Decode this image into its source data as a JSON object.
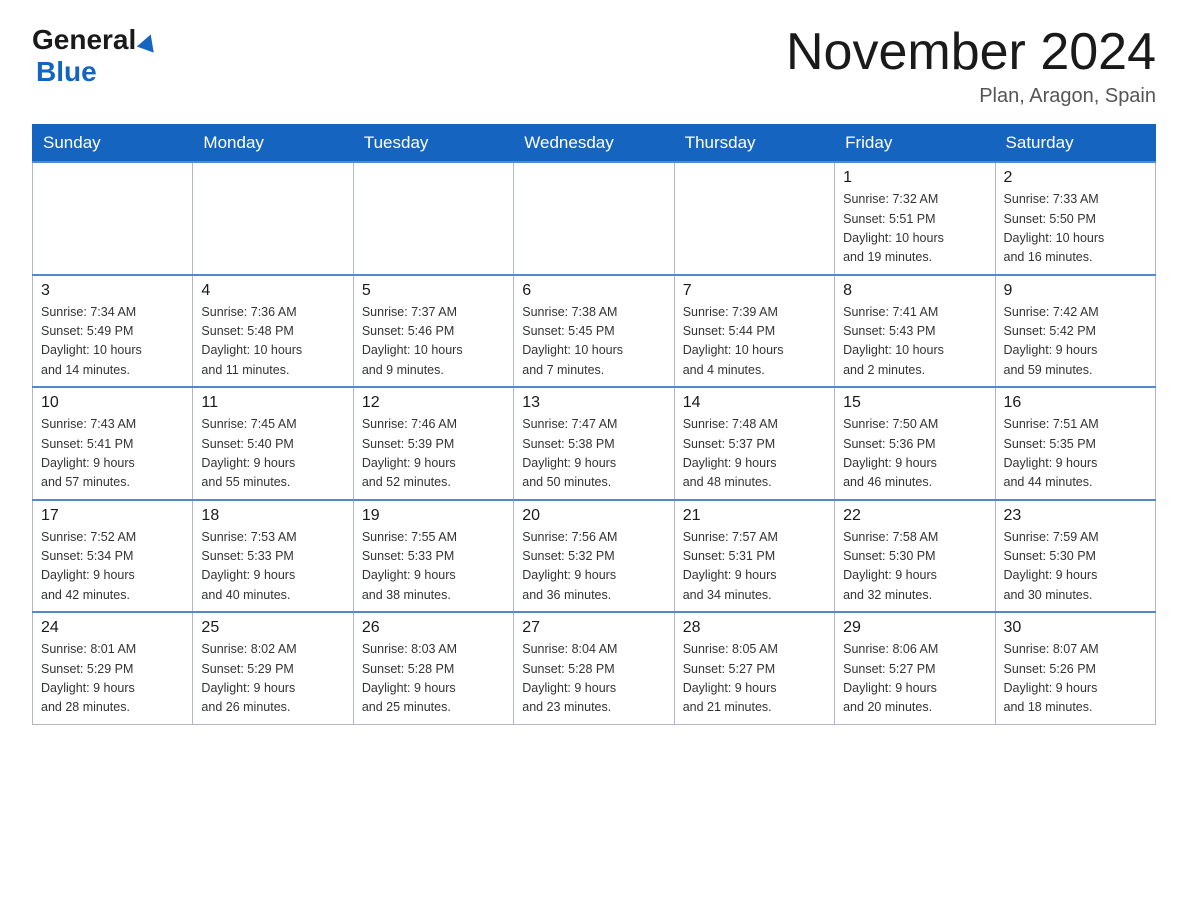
{
  "logo": {
    "general": "General",
    "blue": "Blue"
  },
  "header": {
    "month": "November 2024",
    "location": "Plan, Aragon, Spain"
  },
  "weekdays": [
    "Sunday",
    "Monday",
    "Tuesday",
    "Wednesday",
    "Thursday",
    "Friday",
    "Saturday"
  ],
  "weeks": [
    [
      {
        "day": "",
        "detail": ""
      },
      {
        "day": "",
        "detail": ""
      },
      {
        "day": "",
        "detail": ""
      },
      {
        "day": "",
        "detail": ""
      },
      {
        "day": "",
        "detail": ""
      },
      {
        "day": "1",
        "detail": "Sunrise: 7:32 AM\nSunset: 5:51 PM\nDaylight: 10 hours\nand 19 minutes."
      },
      {
        "day": "2",
        "detail": "Sunrise: 7:33 AM\nSunset: 5:50 PM\nDaylight: 10 hours\nand 16 minutes."
      }
    ],
    [
      {
        "day": "3",
        "detail": "Sunrise: 7:34 AM\nSunset: 5:49 PM\nDaylight: 10 hours\nand 14 minutes."
      },
      {
        "day": "4",
        "detail": "Sunrise: 7:36 AM\nSunset: 5:48 PM\nDaylight: 10 hours\nand 11 minutes."
      },
      {
        "day": "5",
        "detail": "Sunrise: 7:37 AM\nSunset: 5:46 PM\nDaylight: 10 hours\nand 9 minutes."
      },
      {
        "day": "6",
        "detail": "Sunrise: 7:38 AM\nSunset: 5:45 PM\nDaylight: 10 hours\nand 7 minutes."
      },
      {
        "day": "7",
        "detail": "Sunrise: 7:39 AM\nSunset: 5:44 PM\nDaylight: 10 hours\nand 4 minutes."
      },
      {
        "day": "8",
        "detail": "Sunrise: 7:41 AM\nSunset: 5:43 PM\nDaylight: 10 hours\nand 2 minutes."
      },
      {
        "day": "9",
        "detail": "Sunrise: 7:42 AM\nSunset: 5:42 PM\nDaylight: 9 hours\nand 59 minutes."
      }
    ],
    [
      {
        "day": "10",
        "detail": "Sunrise: 7:43 AM\nSunset: 5:41 PM\nDaylight: 9 hours\nand 57 minutes."
      },
      {
        "day": "11",
        "detail": "Sunrise: 7:45 AM\nSunset: 5:40 PM\nDaylight: 9 hours\nand 55 minutes."
      },
      {
        "day": "12",
        "detail": "Sunrise: 7:46 AM\nSunset: 5:39 PM\nDaylight: 9 hours\nand 52 minutes."
      },
      {
        "day": "13",
        "detail": "Sunrise: 7:47 AM\nSunset: 5:38 PM\nDaylight: 9 hours\nand 50 minutes."
      },
      {
        "day": "14",
        "detail": "Sunrise: 7:48 AM\nSunset: 5:37 PM\nDaylight: 9 hours\nand 48 minutes."
      },
      {
        "day": "15",
        "detail": "Sunrise: 7:50 AM\nSunset: 5:36 PM\nDaylight: 9 hours\nand 46 minutes."
      },
      {
        "day": "16",
        "detail": "Sunrise: 7:51 AM\nSunset: 5:35 PM\nDaylight: 9 hours\nand 44 minutes."
      }
    ],
    [
      {
        "day": "17",
        "detail": "Sunrise: 7:52 AM\nSunset: 5:34 PM\nDaylight: 9 hours\nand 42 minutes."
      },
      {
        "day": "18",
        "detail": "Sunrise: 7:53 AM\nSunset: 5:33 PM\nDaylight: 9 hours\nand 40 minutes."
      },
      {
        "day": "19",
        "detail": "Sunrise: 7:55 AM\nSunset: 5:33 PM\nDaylight: 9 hours\nand 38 minutes."
      },
      {
        "day": "20",
        "detail": "Sunrise: 7:56 AM\nSunset: 5:32 PM\nDaylight: 9 hours\nand 36 minutes."
      },
      {
        "day": "21",
        "detail": "Sunrise: 7:57 AM\nSunset: 5:31 PM\nDaylight: 9 hours\nand 34 minutes."
      },
      {
        "day": "22",
        "detail": "Sunrise: 7:58 AM\nSunset: 5:30 PM\nDaylight: 9 hours\nand 32 minutes."
      },
      {
        "day": "23",
        "detail": "Sunrise: 7:59 AM\nSunset: 5:30 PM\nDaylight: 9 hours\nand 30 minutes."
      }
    ],
    [
      {
        "day": "24",
        "detail": "Sunrise: 8:01 AM\nSunset: 5:29 PM\nDaylight: 9 hours\nand 28 minutes."
      },
      {
        "day": "25",
        "detail": "Sunrise: 8:02 AM\nSunset: 5:29 PM\nDaylight: 9 hours\nand 26 minutes."
      },
      {
        "day": "26",
        "detail": "Sunrise: 8:03 AM\nSunset: 5:28 PM\nDaylight: 9 hours\nand 25 minutes."
      },
      {
        "day": "27",
        "detail": "Sunrise: 8:04 AM\nSunset: 5:28 PM\nDaylight: 9 hours\nand 23 minutes."
      },
      {
        "day": "28",
        "detail": "Sunrise: 8:05 AM\nSunset: 5:27 PM\nDaylight: 9 hours\nand 21 minutes."
      },
      {
        "day": "29",
        "detail": "Sunrise: 8:06 AM\nSunset: 5:27 PM\nDaylight: 9 hours\nand 20 minutes."
      },
      {
        "day": "30",
        "detail": "Sunrise: 8:07 AM\nSunset: 5:26 PM\nDaylight: 9 hours\nand 18 minutes."
      }
    ]
  ]
}
